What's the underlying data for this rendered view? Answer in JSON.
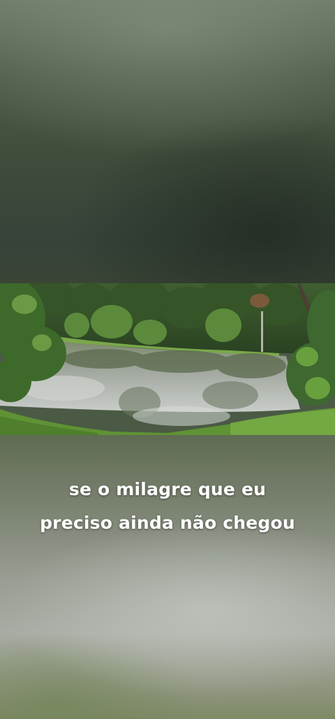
{
  "caption": {
    "line1": "se o milagre que eu",
    "line2": "preciso ainda não chegou"
  },
  "scene": {
    "subject": "pond surrounded by trees",
    "colors": {
      "water": "#9aa39a",
      "foliage_dark": "#2f4a26",
      "foliage_mid": "#4f7a36",
      "grass": "#6a9a3a",
      "sky": "#dfe4e2"
    }
  }
}
